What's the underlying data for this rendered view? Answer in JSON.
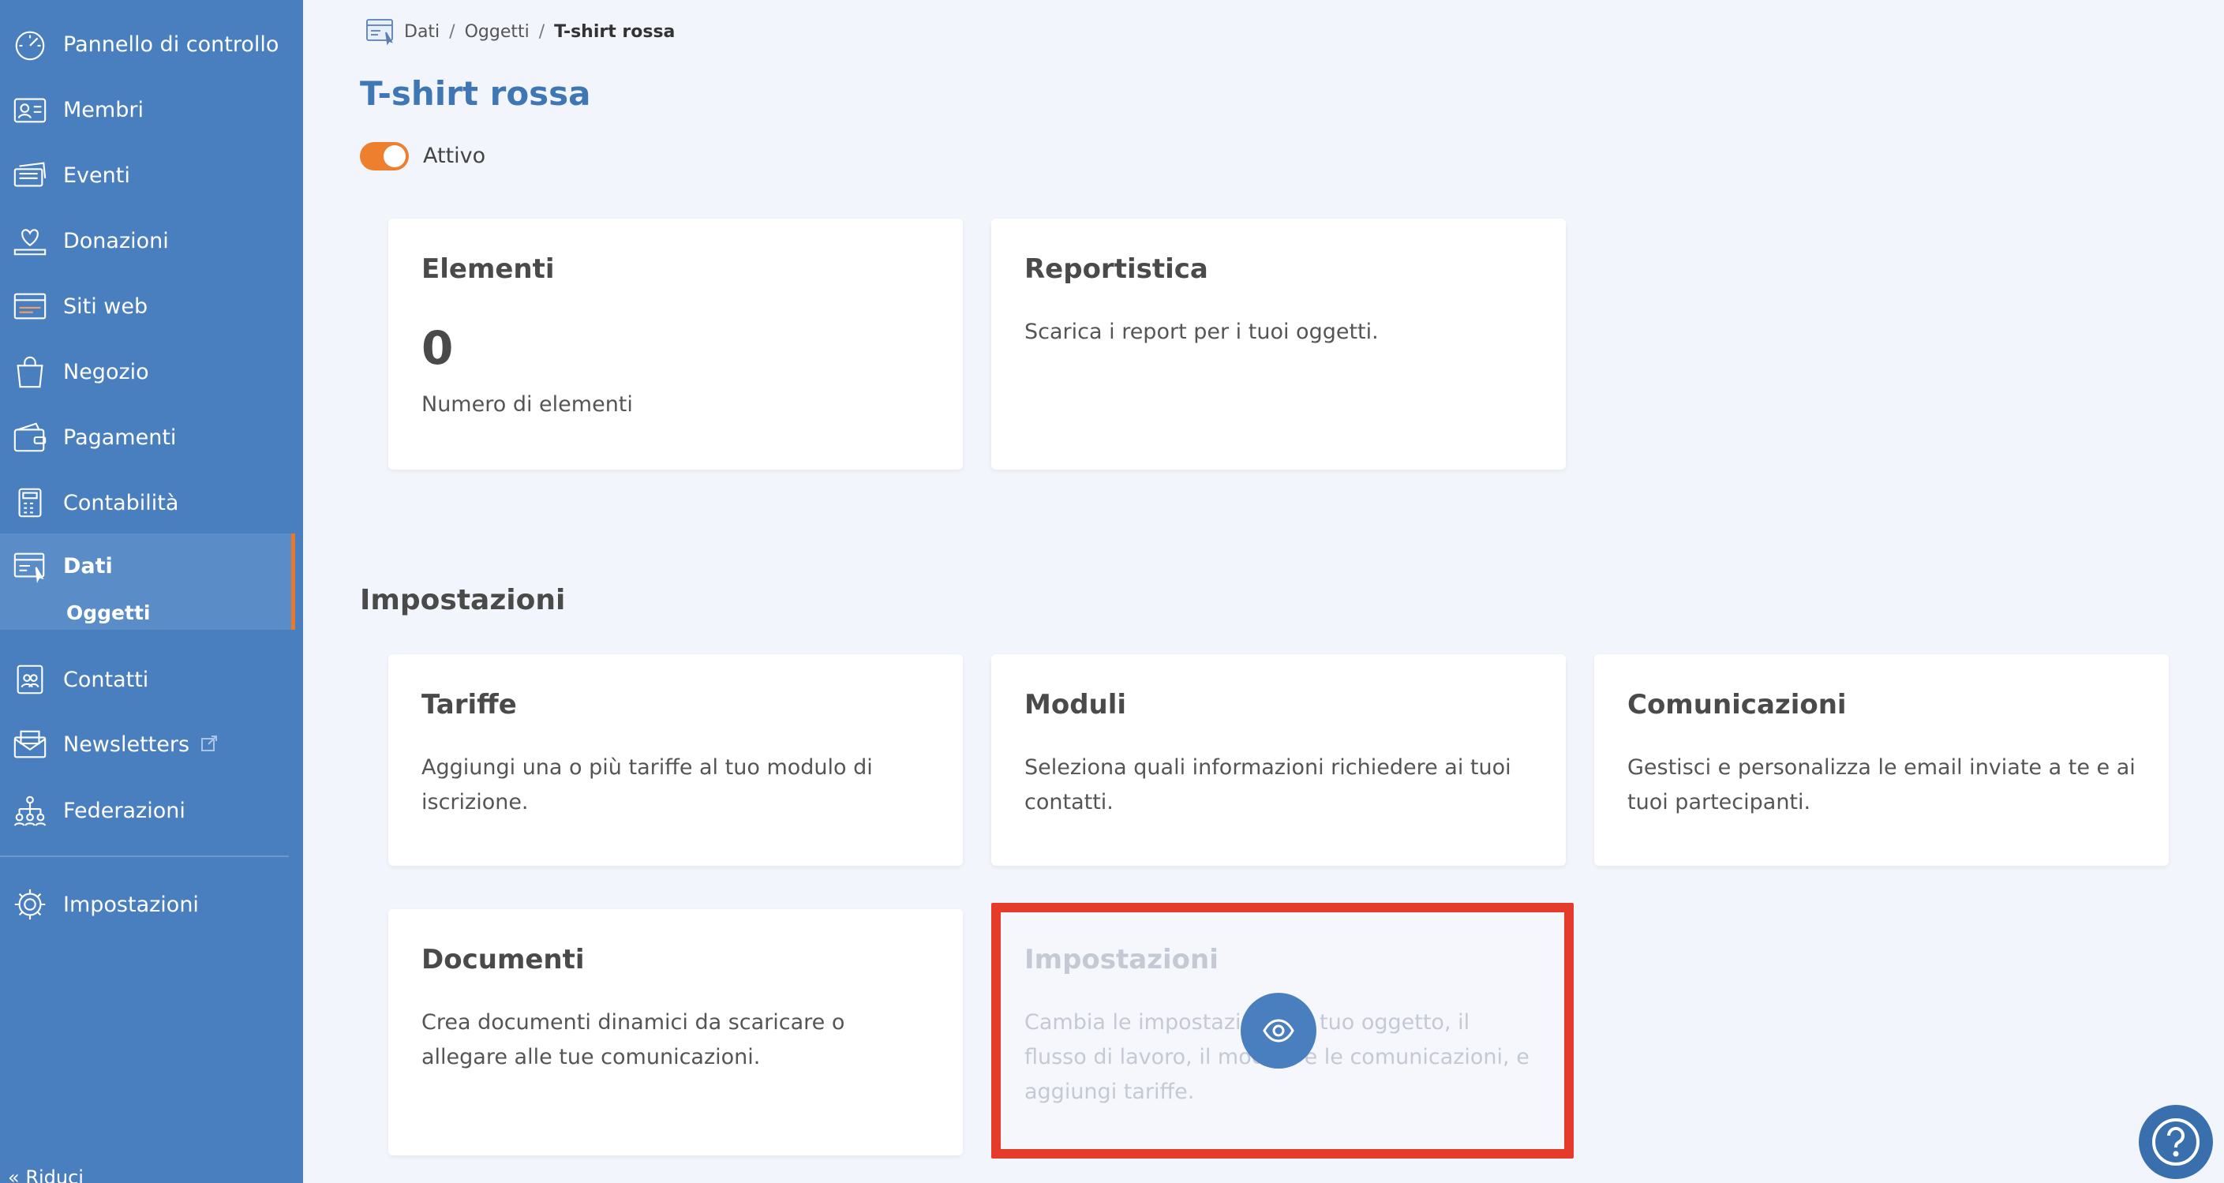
{
  "sidebar": {
    "items": [
      {
        "label": "Pannello di controllo",
        "icon": "dashboard-gauge-icon"
      },
      {
        "label": "Membri",
        "icon": "member-card-icon"
      },
      {
        "label": "Eventi",
        "icon": "event-tickets-icon"
      },
      {
        "label": "Donazioni",
        "icon": "donation-heart-icon"
      },
      {
        "label": "Siti web",
        "icon": "website-icon"
      },
      {
        "label": "Negozio",
        "icon": "shopping-bag-icon"
      },
      {
        "label": "Pagamenti",
        "icon": "wallet-icon"
      },
      {
        "label": "Contabilità",
        "icon": "calculator-icon"
      },
      {
        "label": "Dati",
        "icon": "data-window-icon"
      },
      {
        "label": "Contatti",
        "icon": "contacts-icon"
      },
      {
        "label": "Newsletters",
        "icon": "newsletter-icon"
      },
      {
        "label": "Federazioni",
        "icon": "federation-icon"
      },
      {
        "label": "Impostazioni",
        "icon": "settings-gear-icon"
      }
    ],
    "sub_item": "Oggetti",
    "collapse_label": "« Riduci"
  },
  "breadcrumb": {
    "items": [
      "Dati",
      "Oggetti"
    ],
    "current": "T-shirt rossa"
  },
  "page": {
    "title": "T-shirt rossa",
    "toggle_label": "Attivo",
    "toggle_on": true,
    "accent_color": "#ee7f2e"
  },
  "cards_top": {
    "elementi": {
      "title": "Elementi",
      "number": "0",
      "subtitle": "Numero di elementi"
    },
    "reportistica": {
      "title": "Reportistica",
      "text": "Scarica i report per i tuoi oggetti."
    }
  },
  "settings_section": {
    "title": "Impostazioni",
    "tariffe": {
      "title": "Tariffe",
      "text": "Aggiungi una o più tariffe al tuo modulo di iscrizione."
    },
    "moduli": {
      "title": "Moduli",
      "text": "Seleziona quali informazioni richiedere ai tuoi contatti."
    },
    "comunicazioni": {
      "title": "Comunicazioni",
      "text": "Gestisci e personalizza le email inviate a te e ai tuoi partecipanti."
    },
    "documenti": {
      "title": "Documenti",
      "text": "Crea documenti dinamici da scaricare o allegare alle tue comunicazioni."
    },
    "impostazioni": {
      "title": "Impostazioni",
      "text": "Cambia le impostazioni del tuo oggetto, il flusso di lavoro, il modulo e le comunicazioni, e aggiungi tariffe."
    }
  },
  "colors": {
    "sidebar": "#4a7fbf",
    "title": "#3f76b4",
    "highlight": "#e53b2a"
  }
}
